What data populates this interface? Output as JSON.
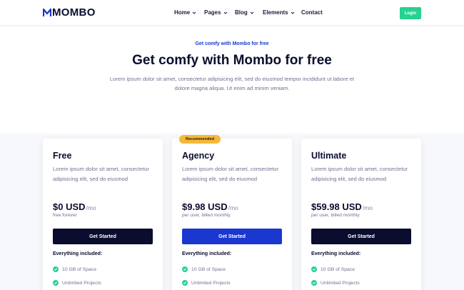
{
  "brand": {
    "name": "MOMBO"
  },
  "nav": {
    "items": [
      {
        "label": "Home",
        "has_dropdown": true
      },
      {
        "label": "Pages",
        "has_dropdown": true
      },
      {
        "label": "Blog",
        "has_dropdown": true
      },
      {
        "label": "Elements",
        "has_dropdown": true
      },
      {
        "label": "Contact",
        "has_dropdown": false
      }
    ],
    "login_label": "Login"
  },
  "hero": {
    "eyebrow": "Get comfy with Mombo for free",
    "title": "Get comfy with Mombo for free",
    "description": "Lorem ipsum dolor sit amet, consectetur adipisicing elit, sed do eiusmod tempor incididunt ut labore et dolore magna aliqua. Ut enim ad minim veniam."
  },
  "pricing": {
    "recommended_badge": "Recommended",
    "included_label": "Everything included:",
    "plans": [
      {
        "name": "Free",
        "description": "Lorem ipsum dolor sit amet, consectetur adipisicing elit, sed do eiusmod",
        "price": "$0 USD",
        "period": "/mo",
        "note": "free forever",
        "cta": "Get Started",
        "features": [
          "10 GB of Space",
          "Unlimited Projects"
        ]
      },
      {
        "name": "Agency",
        "description": "Lorem ipsum dolor sit amet, consectetur adipisicing elit, sed do eiusmod",
        "price": "$9.98 USD",
        "period": "/mo",
        "note": "per user, billed monthly",
        "cta": "Get Started",
        "features": [
          "10 GB of Space",
          "Unlimited Projects"
        ]
      },
      {
        "name": "Ultimate",
        "description": "Lorem ipsum dolor sit amet, consectetur adipisicing elit, sed do eiusmod",
        "price": "$59.98 USD",
        "period": "/mo",
        "note": "per user, billed monthly",
        "cta": "Get Started",
        "features": [
          "10 GB of Space",
          "Unlimited Projects"
        ]
      }
    ]
  },
  "colors": {
    "brand_blue": "#1a37d0",
    "dark_navy": "#0b0d2e",
    "success_green": "#27d190",
    "badge_yellow": "#f6b83a"
  },
  "icons": {
    "dropdown": "chevron-down-icon",
    "feature_check": "check-circle-icon",
    "logo": "mombo-logo-icon"
  }
}
